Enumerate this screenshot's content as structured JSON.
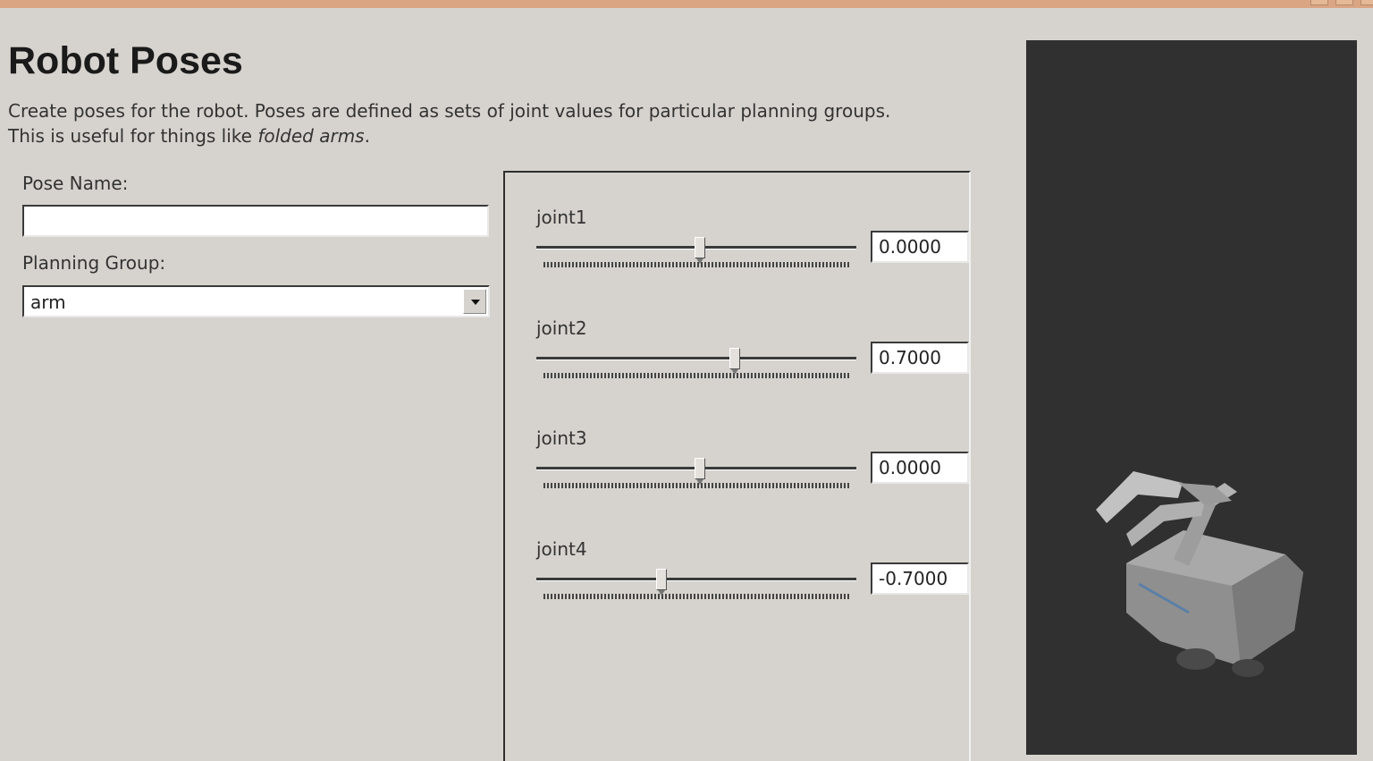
{
  "header": {
    "title": "Robot Poses",
    "description_line1": "Create poses for the robot. Poses are defined as sets of joint values for particular planning groups.",
    "description_line2_prefix": "This is useful for things like ",
    "description_line2_em": "folded arms",
    "description_line2_suffix": "."
  },
  "form": {
    "pose_name_label": "Pose Name:",
    "pose_name_value": "",
    "planning_group_label": "Planning Group:",
    "planning_group_value": "arm"
  },
  "joints": [
    {
      "name": "joint1",
      "value": "0.0000",
      "slider_fraction": 0.51
    },
    {
      "name": "joint2",
      "value": "0.7000",
      "slider_fraction": 0.62
    },
    {
      "name": "joint3",
      "value": "0.0000",
      "slider_fraction": 0.51
    },
    {
      "name": "joint4",
      "value": "-0.7000",
      "slider_fraction": 0.39
    }
  ],
  "colors": {
    "background": "#d6d3ce",
    "titlebar": "#d9a582",
    "viewport": "#303030"
  },
  "icons": {
    "dropdown": "chevron-down-icon",
    "robot_model": "robot-arm-model"
  }
}
